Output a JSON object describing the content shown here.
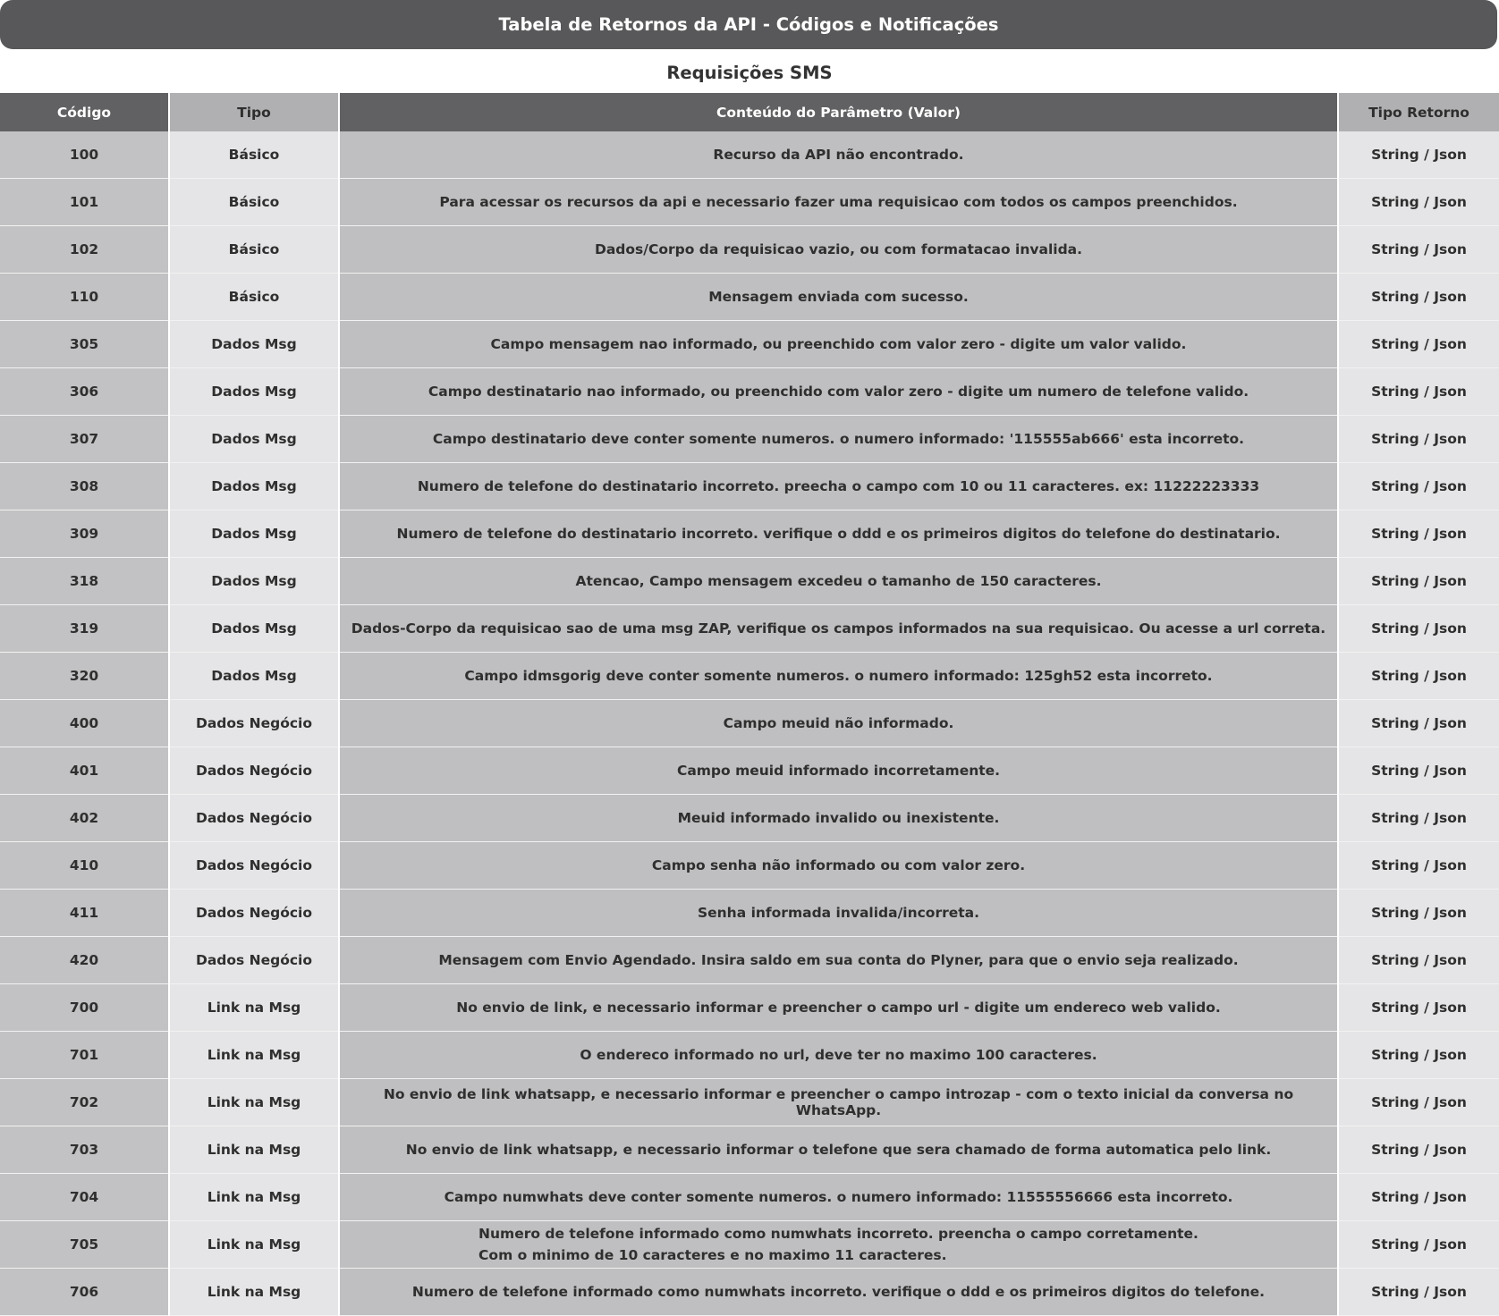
{
  "header": {
    "title": "Tabela de Retornos da API - Códigos e Notificações",
    "subtitle": "Requisições SMS"
  },
  "table": {
    "columns": [
      "Código",
      "Tipo",
      "Conteúdo do Parâmetro (Valor)",
      "Tipo Retorno"
    ],
    "rows": [
      {
        "code": "100",
        "type": "Básico",
        "content": "Recurso da API não encontrado.",
        "return_type": "String / Json"
      },
      {
        "code": "101",
        "type": "Básico",
        "content": "Para acessar os recursos da api e necessario fazer uma requisicao com todos os campos preenchidos.",
        "return_type": "String / Json"
      },
      {
        "code": "102",
        "type": "Básico",
        "content": "Dados/Corpo da requisicao vazio, ou com formatacao invalida.",
        "return_type": "String / Json"
      },
      {
        "code": "110",
        "type": "Básico",
        "content": "Mensagem enviada com sucesso.",
        "return_type": "String / Json"
      },
      {
        "code": "305",
        "type": "Dados Msg",
        "content": "Campo mensagem nao informado, ou preenchido com valor zero - digite um valor valido.",
        "return_type": "String / Json"
      },
      {
        "code": "306",
        "type": "Dados Msg",
        "content": "Campo destinatario nao informado, ou preenchido com valor zero - digite um numero de telefone valido.",
        "return_type": "String / Json"
      },
      {
        "code": "307",
        "type": "Dados Msg",
        "content": "Campo destinatario deve conter somente numeros. o numero informado: '115555ab666' esta incorreto.",
        "return_type": "String / Json"
      },
      {
        "code": "308",
        "type": "Dados Msg",
        "content": "Numero de telefone do destinatario incorreto. preecha o campo com 10 ou 11 caracteres. ex: 11222223333",
        "return_type": "String / Json"
      },
      {
        "code": "309",
        "type": "Dados Msg",
        "content": "Numero de telefone do destinatario incorreto. verifique o ddd e os primeiros digitos do telefone do destinatario.",
        "return_type": "String / Json"
      },
      {
        "code": "318",
        "type": "Dados Msg",
        "content": "Atencao, Campo mensagem excedeu o tamanho de 150 caracteres.",
        "return_type": "String / Json"
      },
      {
        "code": "319",
        "type": "Dados Msg",
        "content": "Dados-Corpo da requisicao sao de uma msg ZAP, verifique os campos informados na sua requisicao. Ou acesse a url correta.",
        "return_type": "String / Json"
      },
      {
        "code": "320",
        "type": "Dados Msg",
        "content": "Campo idmsgorig deve conter somente numeros. o numero informado:  125gh52 esta incorreto.",
        "return_type": "String / Json"
      },
      {
        "code": "400",
        "type": "Dados Negócio",
        "content": "Campo meuid não informado.",
        "return_type": "String / Json"
      },
      {
        "code": "401",
        "type": "Dados Negócio",
        "content": "Campo meuid informado incorretamente.",
        "return_type": "String / Json"
      },
      {
        "code": "402",
        "type": "Dados Negócio",
        "content": "Meuid informado invalido ou inexistente.",
        "return_type": "String / Json"
      },
      {
        "code": "410",
        "type": "Dados Negócio",
        "content": "Campo senha não informado ou com valor zero.",
        "return_type": "String / Json"
      },
      {
        "code": "411",
        "type": "Dados Negócio",
        "content": "Senha informada invalida/incorreta.",
        "return_type": "String / Json"
      },
      {
        "code": "420",
        "type": "Dados Negócio",
        "content": "Mensagem com Envio Agendado. Insira saldo em sua conta do Plyner, para que o envio seja realizado.",
        "return_type": "String / Json"
      },
      {
        "code": "700",
        "type": "Link na Msg",
        "content": "No envio de link, e necessario informar e preencher o campo url - digite um endereco web valido.",
        "return_type": "String / Json"
      },
      {
        "code": "701",
        "type": "Link na Msg",
        "content": "O endereco informado no url, deve ter no maximo 100 caracteres.",
        "return_type": "String / Json"
      },
      {
        "code": "702",
        "type": "Link na Msg",
        "content": "No envio de link whatsapp, e necessario informar e preencher o campo introzap - com o texto inicial da conversa no WhatsApp.",
        "return_type": "String / Json"
      },
      {
        "code": "703",
        "type": "Link na Msg",
        "content": "No envio de link whatsapp, e necessario informar o telefone que sera chamado de forma automatica pelo link.",
        "return_type": "String / Json"
      },
      {
        "code": "704",
        "type": "Link na Msg",
        "content": "Campo numwhats deve conter somente numeros. o numero informado: 11555556666 esta incorreto.",
        "return_type": "String / Json"
      },
      {
        "code": "705",
        "type": "Link na Msg",
        "content": "Numero de telefone informado como numwhats incorreto. preencha o campo corretamente.",
        "content_line2": "Com o minimo de 10 caracteres e no maximo 11 caracteres.",
        "return_type": "String / Json"
      },
      {
        "code": "706",
        "type": "Link na Msg",
        "content": "Numero de telefone informado como numwhats incorreto. verifique o ddd e os primeiros digitos do telefone.",
        "return_type": "String / Json"
      }
    ]
  }
}
